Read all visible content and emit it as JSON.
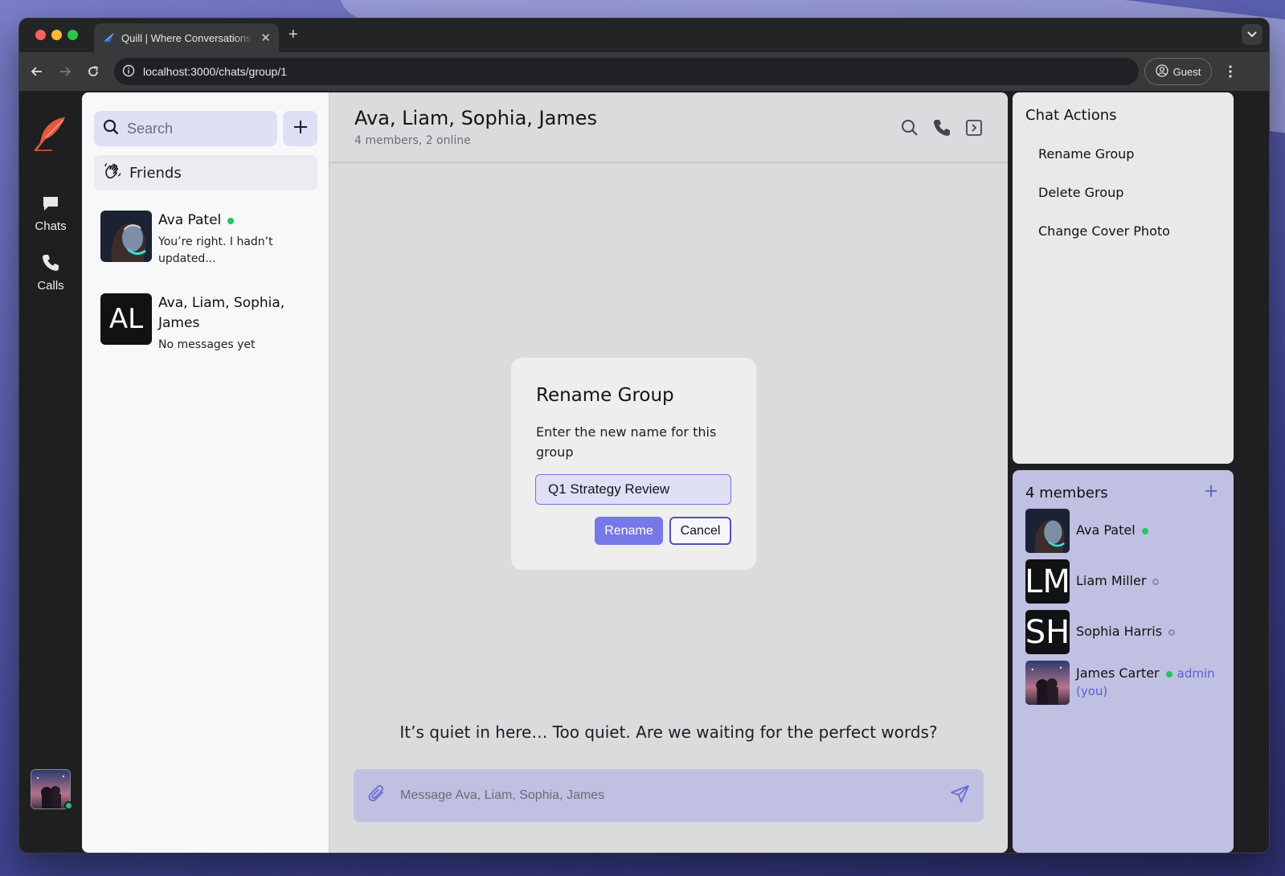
{
  "browser": {
    "tab_title": "Quill | Where Conversations F",
    "url": "localhost:3000/chats/group/1",
    "profile_label": "Guest"
  },
  "rail": {
    "chats_label": "Chats",
    "calls_label": "Calls"
  },
  "sidebar": {
    "search_placeholder": "Search",
    "friends_label": "Friends",
    "chats": [
      {
        "name": "Ava Patel",
        "preview": "You’re right. I hadn’t updated...",
        "online": true
      },
      {
        "name": "Ava, Liam, Sophia, James",
        "preview": "No messages yet",
        "initials": "AL"
      }
    ]
  },
  "conversation": {
    "title": "Ava, Liam, Sophia, James",
    "subtitle": "4 members, 2 online",
    "empty_message": "It’s quiet in here… Too quiet. Are we waiting for the perfect words?",
    "composer_placeholder": "Message Ava, Liam, Sophia, James"
  },
  "rename_modal": {
    "title": "Rename Group",
    "description": "Enter the new name for this group",
    "input_value": "Q1 Strategy Review",
    "rename_label": "Rename",
    "cancel_label": "Cancel"
  },
  "chat_actions": {
    "title": "Chat Actions",
    "items": [
      "Rename Group",
      "Delete Group",
      "Change Cover Photo"
    ]
  },
  "members": {
    "title": "4 members",
    "list": [
      {
        "name": "Ava Patel",
        "status": "online"
      },
      {
        "name": "Liam Miller",
        "status": "offline",
        "initials": "LM"
      },
      {
        "name": "Sophia Harris",
        "status": "offline",
        "initials": "SH"
      },
      {
        "name": "James Carter",
        "status": "online",
        "role": "admin",
        "you": "(you)"
      }
    ]
  },
  "colors": {
    "accent": "#7578e6",
    "online": "#22c55e",
    "members_panel": "#c0c0e2"
  }
}
